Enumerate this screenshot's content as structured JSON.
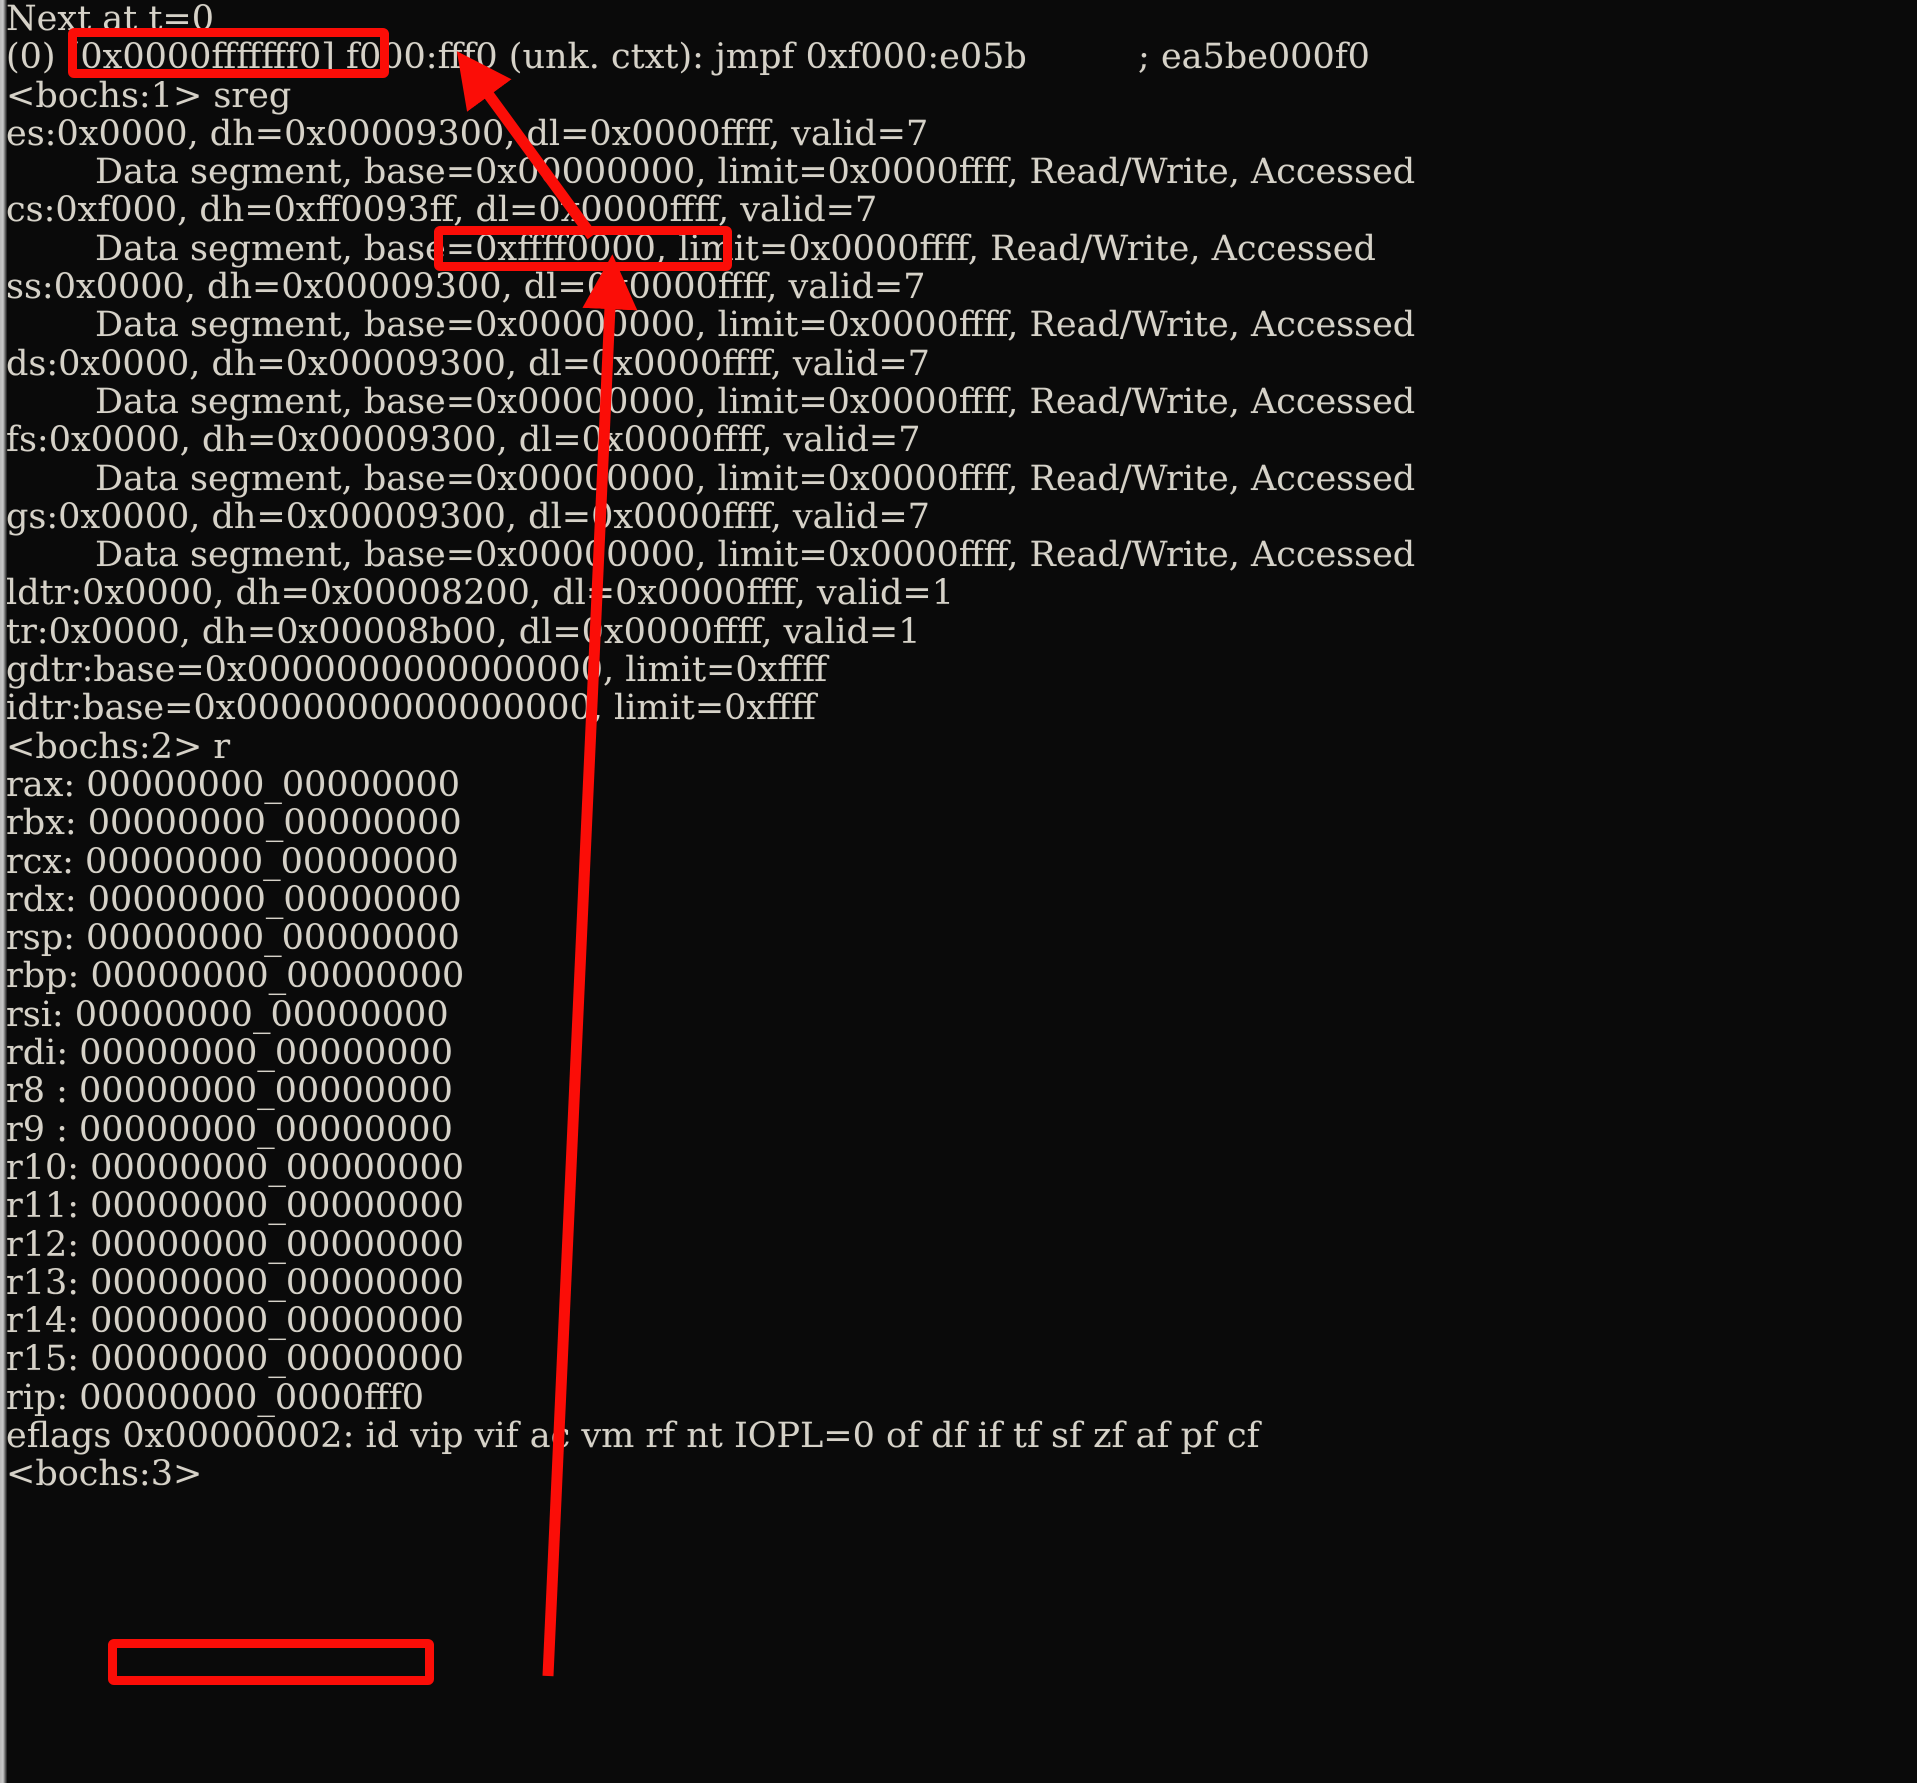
{
  "terminal": {
    "background_color": "#0a0a0a",
    "text_color": "#d6d2c8",
    "annotation_color": "#fb0d07",
    "lines": [
      "Next at t=0",
      "(0) [0x0000fffffff0] f000:fff0 (unk. ctxt): jmpf 0xf000:e05b          ; ea5be000f0",
      "<bochs:1> sreg",
      "es:0x0000, dh=0x00009300, dl=0x0000ffff, valid=7",
      "        Data segment, base=0x00000000, limit=0x0000ffff, Read/Write, Accessed",
      "cs:0xf000, dh=0xff0093ff, dl=0x0000ffff, valid=7",
      "        Data segment, base=0xffff0000, limit=0x0000ffff, Read/Write, Accessed",
      "ss:0x0000, dh=0x00009300, dl=0x0000ffff, valid=7",
      "        Data segment, base=0x00000000, limit=0x0000ffff, Read/Write, Accessed",
      "ds:0x0000, dh=0x00009300, dl=0x0000ffff, valid=7",
      "        Data segment, base=0x00000000, limit=0x0000ffff, Read/Write, Accessed",
      "fs:0x0000, dh=0x00009300, dl=0x0000ffff, valid=7",
      "        Data segment, base=0x00000000, limit=0x0000ffff, Read/Write, Accessed",
      "gs:0x0000, dh=0x00009300, dl=0x0000ffff, valid=7",
      "        Data segment, base=0x00000000, limit=0x0000ffff, Read/Write, Accessed",
      "ldtr:0x0000, dh=0x00008200, dl=0x0000ffff, valid=1",
      "tr:0x0000, dh=0x00008b00, dl=0x0000ffff, valid=1",
      "gdtr:base=0x0000000000000000, limit=0xffff",
      "idtr:base=0x0000000000000000, limit=0xffff",
      "<bochs:2> r",
      "rax: 00000000_00000000",
      "rbx: 00000000_00000000",
      "rcx: 00000000_00000000",
      "rdx: 00000000_00000000",
      "rsp: 00000000_00000000",
      "rbp: 00000000_00000000",
      "rsi: 00000000_00000000",
      "rdi: 00000000_00000000",
      "r8 : 00000000_00000000",
      "r9 : 00000000_00000000",
      "r10: 00000000_00000000",
      "r11: 00000000_00000000",
      "r12: 00000000_00000000",
      "r13: 00000000_00000000",
      "r14: 00000000_00000000",
      "r15: 00000000_00000000",
      "rip: 00000000_0000fff0",
      "eflags 0x00000002: id vip vif ac vm rf nt IOPL=0 of df if tf sf zf af pf cf",
      "<bochs:3>"
    ],
    "prompts": [
      {
        "label": "<bochs:1>",
        "command": "sreg"
      },
      {
        "label": "<bochs:2>",
        "command": "r"
      },
      {
        "label": "<bochs:3>",
        "command": ""
      }
    ],
    "next_at": "Next at t=0",
    "current_instruction": {
      "cpu": "(0)",
      "linear_address": "[0x0000fffffff0]",
      "logical_address": "f000:fff0",
      "context": "(unk. ctxt)",
      "mnemonic": "jmpf",
      "operands": "0xf000:e05b",
      "bytes_comment": "; ea5be000f0"
    },
    "segment_registers": [
      {
        "name": "es",
        "selector": "0x0000",
        "dh": "0x00009300",
        "dl": "0x0000ffff",
        "valid": "7",
        "descriptor": {
          "type": "Data segment",
          "base": "0x00000000",
          "limit": "0x0000ffff",
          "rights": "Read/Write",
          "accessed": "Accessed"
        }
      },
      {
        "name": "cs",
        "selector": "0xf000",
        "dh": "0xff0093ff",
        "dl": "0x0000ffff",
        "valid": "7",
        "descriptor": {
          "type": "Data segment",
          "base": "0xffff0000",
          "limit": "0x0000ffff",
          "rights": "Read/Write",
          "accessed": "Accessed"
        }
      },
      {
        "name": "ss",
        "selector": "0x0000",
        "dh": "0x00009300",
        "dl": "0x0000ffff",
        "valid": "7",
        "descriptor": {
          "type": "Data segment",
          "base": "0x00000000",
          "limit": "0x0000ffff",
          "rights": "Read/Write",
          "accessed": "Accessed"
        }
      },
      {
        "name": "ds",
        "selector": "0x0000",
        "dh": "0x00009300",
        "dl": "0x0000ffff",
        "valid": "7",
        "descriptor": {
          "type": "Data segment",
          "base": "0x00000000",
          "limit": "0x0000ffff",
          "rights": "Read/Write",
          "accessed": "Accessed"
        }
      },
      {
        "name": "fs",
        "selector": "0x0000",
        "dh": "0x00009300",
        "dl": "0x0000ffff",
        "valid": "7",
        "descriptor": {
          "type": "Data segment",
          "base": "0x00000000",
          "limit": "0x0000ffff",
          "rights": "Read/Write",
          "accessed": "Accessed"
        }
      },
      {
        "name": "gs",
        "selector": "0x0000",
        "dh": "0x00009300",
        "dl": "0x0000ffff",
        "valid": "7",
        "descriptor": {
          "type": "Data segment",
          "base": "0x00000000",
          "limit": "0x0000ffff",
          "rights": "Read/Write",
          "accessed": "Accessed"
        }
      },
      {
        "name": "ldtr",
        "selector": "0x0000",
        "dh": "0x00008200",
        "dl": "0x0000ffff",
        "valid": "1"
      },
      {
        "name": "tr",
        "selector": "0x0000",
        "dh": "0x00008b00",
        "dl": "0x0000ffff",
        "valid": "1"
      }
    ],
    "descriptor_tables": [
      {
        "name": "gdtr",
        "base": "0x0000000000000000",
        "limit": "0xffff"
      },
      {
        "name": "idtr",
        "base": "0x0000000000000000",
        "limit": "0xffff"
      }
    ],
    "general_registers": [
      {
        "name": "rax",
        "value": "00000000_00000000"
      },
      {
        "name": "rbx",
        "value": "00000000_00000000"
      },
      {
        "name": "rcx",
        "value": "00000000_00000000"
      },
      {
        "name": "rdx",
        "value": "00000000_00000000"
      },
      {
        "name": "rsp",
        "value": "00000000_00000000"
      },
      {
        "name": "rbp",
        "value": "00000000_00000000"
      },
      {
        "name": "rsi",
        "value": "00000000_00000000"
      },
      {
        "name": "rdi",
        "value": "00000000_00000000"
      },
      {
        "name": "r8 ",
        "value": "00000000_00000000"
      },
      {
        "name": "r9 ",
        "value": "00000000_00000000"
      },
      {
        "name": "r10",
        "value": "00000000_00000000"
      },
      {
        "name": "r11",
        "value": "00000000_00000000"
      },
      {
        "name": "r12",
        "value": "00000000_00000000"
      },
      {
        "name": "r13",
        "value": "00000000_00000000"
      },
      {
        "name": "r14",
        "value": "00000000_00000000"
      },
      {
        "name": "r15",
        "value": "00000000_00000000"
      },
      {
        "name": "rip",
        "value": "00000000_0000fff0"
      }
    ],
    "eflags": {
      "raw": "0x00000002",
      "flags": [
        "id",
        "vip",
        "vif",
        "ac",
        "vm",
        "rf",
        "nt",
        "IOPL=0",
        "of",
        "df",
        "if",
        "tf",
        "sf",
        "zf",
        "af",
        "pf",
        "cf"
      ]
    }
  },
  "annotations": {
    "color": "#fb0d07",
    "boxes": [
      {
        "id": "highlight-linear-address",
        "text": "[0x0000fffffff0]"
      },
      {
        "id": "highlight-cs-base",
        "text": "base=0xffff0000,"
      },
      {
        "id": "highlight-rip-value",
        "text": "00000000_0000fff0"
      }
    ],
    "arrows": [
      {
        "id": "arrow-cs-base-to-linear-address",
        "from": "base=0xffff0000,",
        "to": "[0x0000fffffff0]"
      },
      {
        "id": "arrow-rip-to-cs-base",
        "from": "00000000_0000fff0",
        "to": "base=0xffff0000,"
      }
    ]
  }
}
